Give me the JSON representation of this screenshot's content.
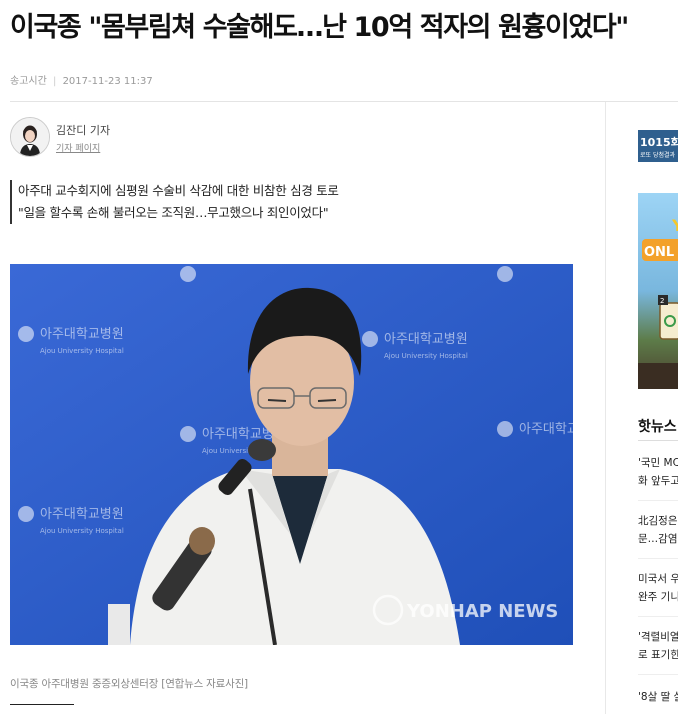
{
  "article": {
    "headline": "이국종 \"몸부림쳐 수술해도…난 10억 적자의 원흉이었다\"",
    "meta_label": "송고시간",
    "meta_separator": "|",
    "meta_datetime": "2017-11-23 11:37"
  },
  "reporter": {
    "name": "김잔디 기자",
    "page_link": "기자 페이지"
  },
  "subheads": [
    "아주대 교수회지에 심평원 수술비 삭감에 대한 비참한 심경 토로",
    "\"일을 할수록 손해 불러오는 조직원…무고했으나 죄인이었다\""
  ],
  "photo": {
    "backdrop_text": [
      "아주대학교병원",
      "Ajou University Hospital"
    ],
    "watermark": "YONHAP NEWS",
    "caption": "이국종 아주대병원 중증외상센터장 [연합뉴스 자료사진]"
  },
  "sidebar": {
    "ad": {
      "big": "1015회",
      "small": "로또 당첨결과"
    },
    "game_banner": {
      "top_text": "Y",
      "logo_text": "ONL",
      "badge": "2"
    },
    "hot_news_title": "핫뉴스",
    "hot_news": [
      [
        "'국민 MC",
        "화 앞두고"
      ],
      [
        "北김정은",
        "문…감염"
      ],
      [
        "미국서 우",
        "완주 기니"
      ],
      [
        "'격렬비열",
        "로 표기한"
      ],
      [
        "'8살 딸 살"
      ]
    ]
  },
  "colors": {
    "photo_backdrop": "#2c5bc9",
    "ad_blue": "#2f5f8e",
    "headline": "#111111"
  }
}
